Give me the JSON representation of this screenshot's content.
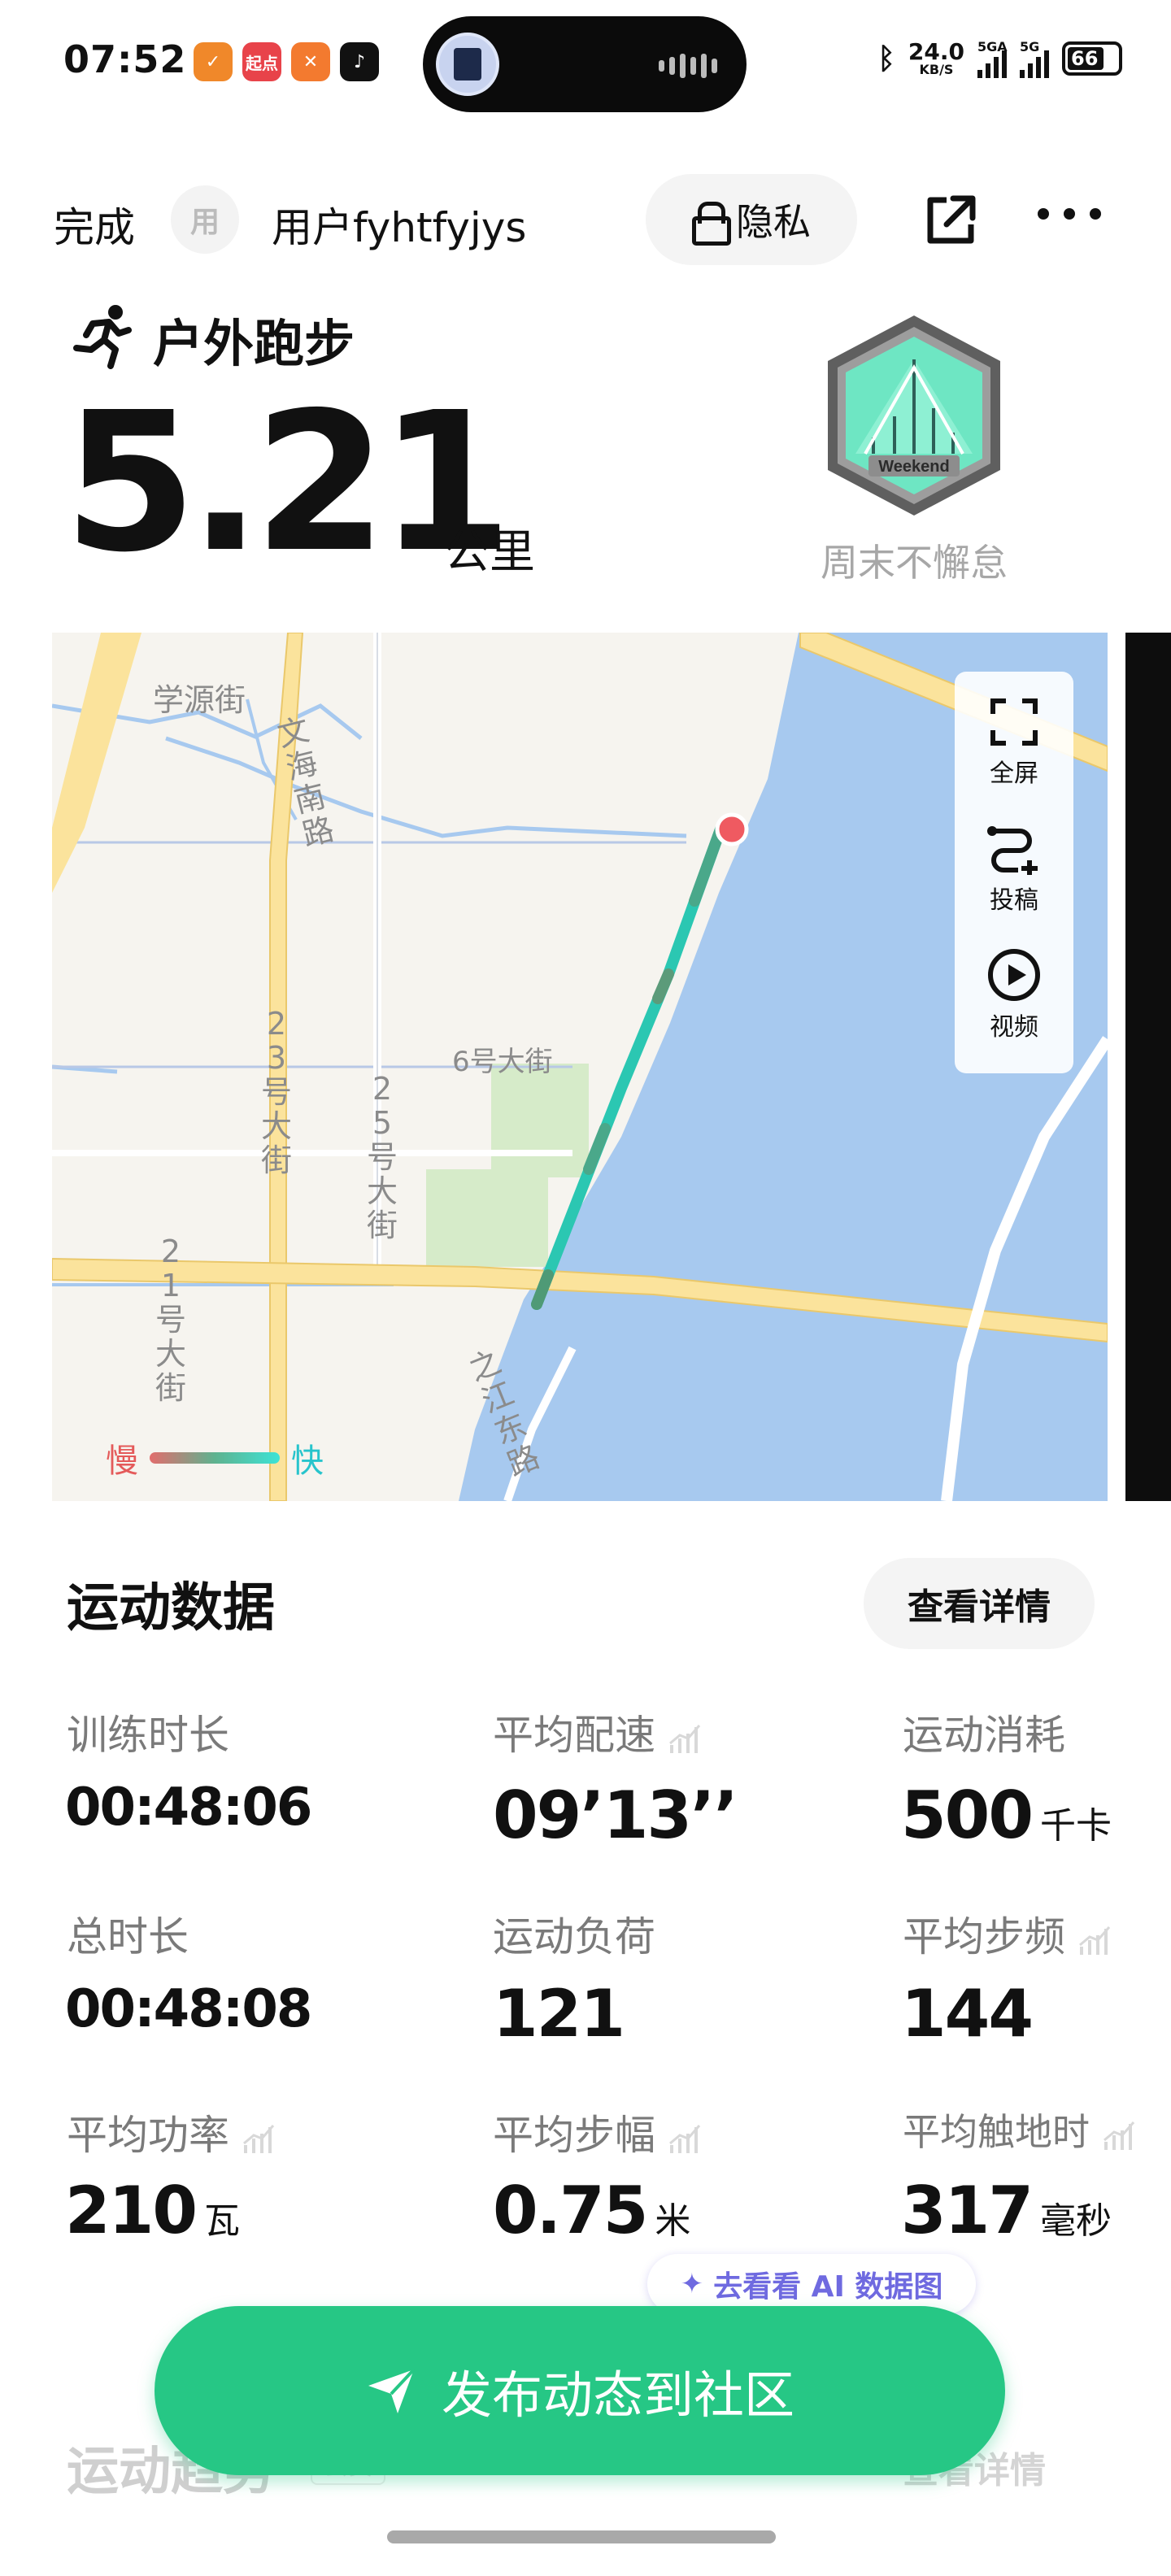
{
  "status_bar": {
    "time": "07:52",
    "apps": [
      {
        "icon": "app-orange-icon",
        "label": "",
        "color": "#f0882a"
      },
      {
        "icon": "qidian-icon",
        "label": "起点",
        "color": "#e8434a"
      },
      {
        "icon": "app-person-icon",
        "label": "",
        "color": "#f37a2f"
      },
      {
        "icon": "tiktok-icon",
        "label": "",
        "color": "#111111"
      }
    ],
    "net_speed": "24.0",
    "net_speed_unit": "KB/S",
    "signal1_label": "5GA",
    "signal2_label": "5G",
    "battery": "66"
  },
  "header": {
    "done_label": "完成",
    "avatar_text": "用",
    "username": "用户fyhtfyjys",
    "privacy_label": "隐私"
  },
  "activity": {
    "title": "户外跑步",
    "distance": "5.21",
    "distance_unit": "公里",
    "badge_text": "Weekend",
    "badge_label": "周末不懈怠"
  },
  "map": {
    "labels": {
      "xueyuan": "学源街",
      "wenhai": "文海南路",
      "street23": "23号大街",
      "street25": "25号大街",
      "street6": "6号大街",
      "street21": "21号大街",
      "river_road": "之江东路"
    },
    "controls": {
      "fullscreen": "全屏",
      "submit": "投稿",
      "video": "视频"
    },
    "legend_slow": "慢",
    "legend_fast": "快"
  },
  "stats": {
    "title": "运动数据",
    "details_label": "查看详情",
    "items": [
      {
        "label": "训练时长",
        "value": "00:48:06",
        "unit": ""
      },
      {
        "label": "平均配速",
        "value": "09’13’’",
        "unit": ""
      },
      {
        "label": "运动消耗",
        "value": "500",
        "unit": "千卡"
      },
      {
        "label": "总时长",
        "value": "00:48:08",
        "unit": ""
      },
      {
        "label": "运动负荷",
        "value": "121",
        "unit": ""
      },
      {
        "label": "平均步频",
        "value": "144",
        "unit": ""
      },
      {
        "label": "平均功率",
        "value": "210",
        "unit": "瓦"
      },
      {
        "label": "平均步幅",
        "value": "0.75",
        "unit": "米"
      },
      {
        "label": "平均触地时",
        "value": "317",
        "unit": "毫秒"
      }
    ]
  },
  "ai_chip": {
    "label": "去看看 AI 数据图"
  },
  "trend": {
    "title": "运动趋势",
    "tag": "会员",
    "details_label": "查看详情"
  },
  "publish": {
    "label": "发布动态到社区"
  },
  "colors": {
    "accent_green": "#26c785",
    "map_water": "#a7c9ef",
    "map_road": "#fbe39c",
    "route_start": "#ef5a61"
  }
}
